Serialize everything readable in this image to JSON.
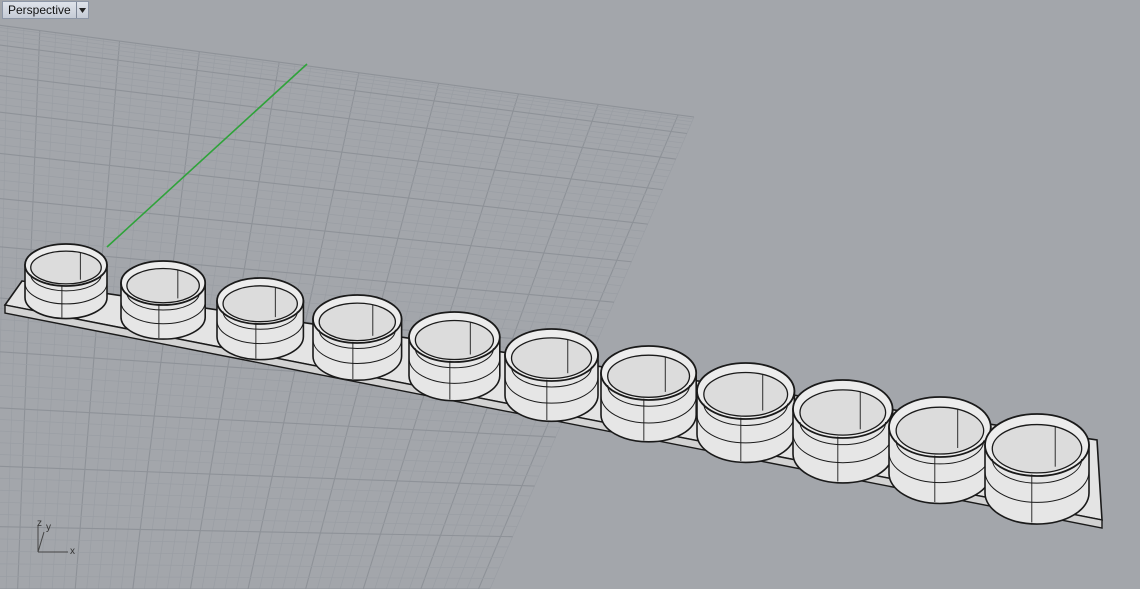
{
  "viewport": {
    "title": "Perspective",
    "dropdown_icon": "triangle-down-icon",
    "axes": {
      "x": "x",
      "y": "y",
      "z": "z"
    }
  },
  "model": {
    "ring_count": 11,
    "colors": {
      "background": "#a3a6ab",
      "grid_minor": "#9a9ea4",
      "grid_major": "#8e9298",
      "y_axis": "#2fa33a",
      "object_fill": "#e6e6e6",
      "object_edge": "#1a1a1a"
    }
  }
}
